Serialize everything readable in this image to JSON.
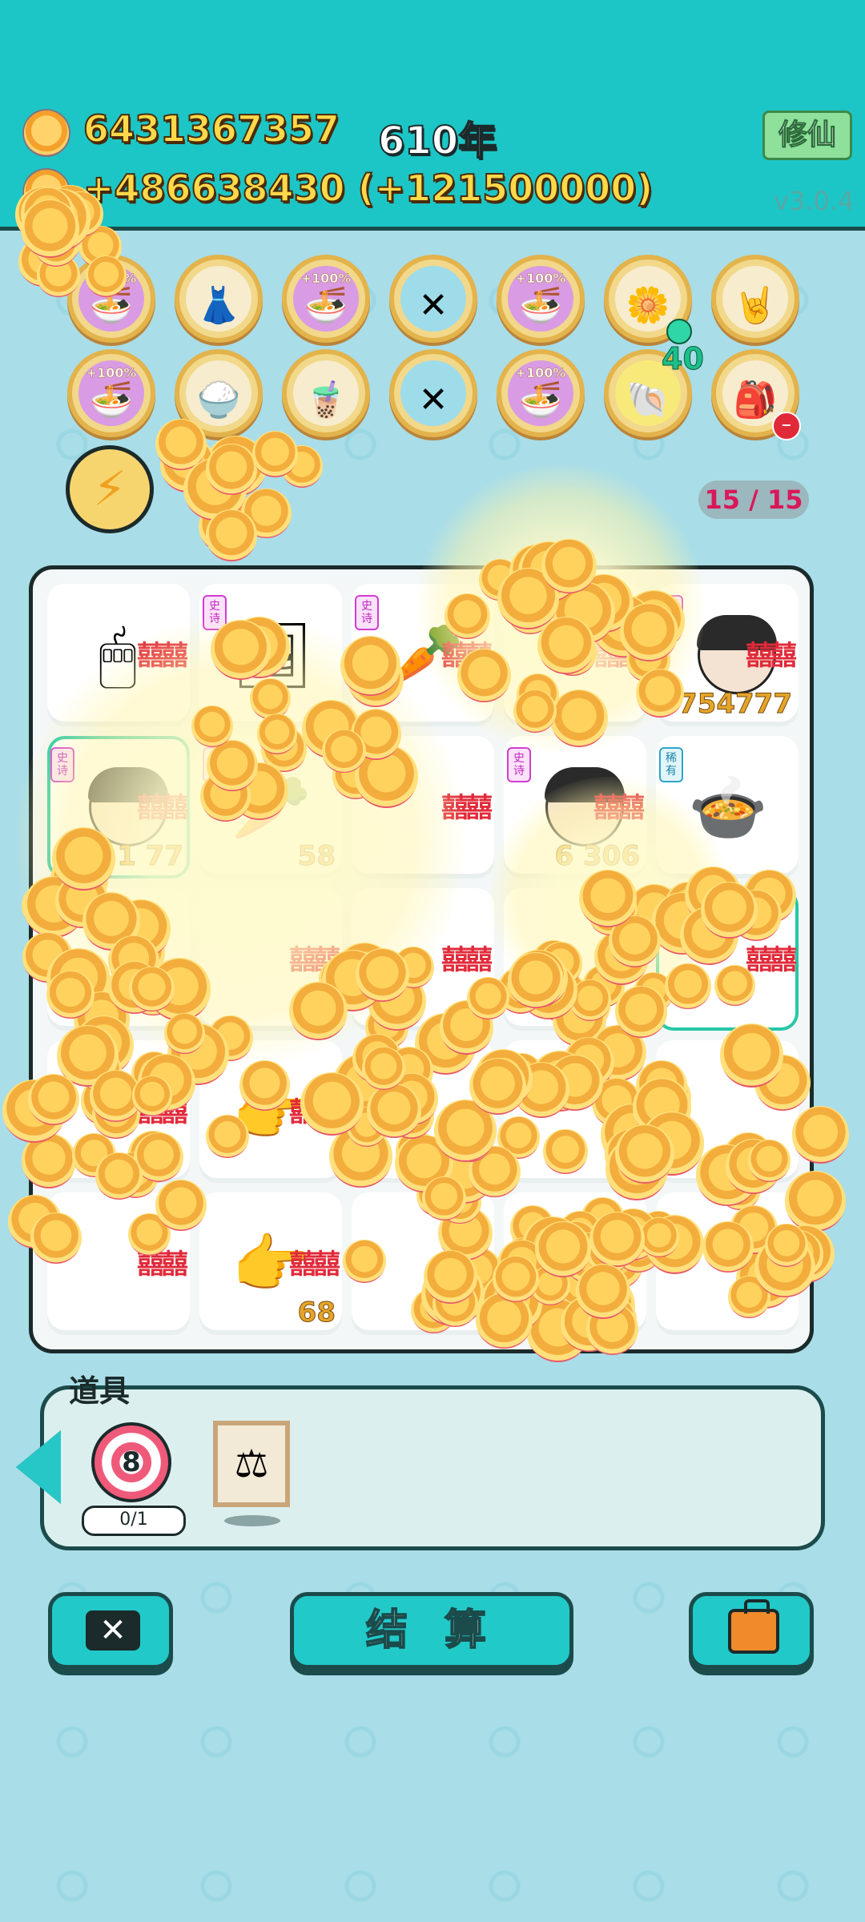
{
  "header": {
    "coins": "6431367357",
    "income": "+486638430 (+121500000)",
    "year": "610年",
    "mode_button": "修仙",
    "version": "v3.0.4"
  },
  "skills": [
    {
      "icon": "cup-boost-icon",
      "label": "+100%"
    },
    {
      "icon": "skirt-icon",
      "label": ""
    },
    {
      "icon": "cup-boost-icon",
      "label": "+100%"
    },
    {
      "icon": "crossed-sticks-icon",
      "label": ""
    },
    {
      "icon": "cup-boost-icon",
      "label": "+100%"
    },
    {
      "icon": "flower-pot-icon",
      "label": ""
    },
    {
      "icon": "rock-hand-icon",
      "label": ""
    },
    {
      "icon": "cup-boost-icon",
      "label": "+100%"
    },
    {
      "icon": "rice-cooker-icon",
      "label": ""
    },
    {
      "icon": "bubble-tea-icon",
      "label": ""
    },
    {
      "icon": "crossed-sticks-icon",
      "label": ""
    },
    {
      "icon": "cup-boost-icon",
      "label": "+100%"
    },
    {
      "icon": "shell-icon",
      "label": ""
    },
    {
      "icon": "bag-icon",
      "label": ""
    }
  ],
  "flower_badge": "40",
  "counter": "15 / 15",
  "board": {
    "cells": [
      {
        "art": "mouse-icon",
        "tag": "",
        "xi": "囍",
        "num": ""
      },
      {
        "art": "frame-icon",
        "tag": "史诗",
        "xi": "",
        "num": ""
      },
      {
        "art": "carrot-icon",
        "tag": "史诗",
        "xi": "囍",
        "num": ""
      },
      {
        "art": "",
        "tag": "",
        "xi": "囍",
        "num": ""
      },
      {
        "art": "face-icon",
        "tag": "史诗",
        "xi": "囍",
        "num": "754777"
      },
      {
        "art": "face-icon",
        "tag": "史诗",
        "xi": "囍",
        "num": "1      77"
      },
      {
        "art": "carrot-icon",
        "tag": "史诗",
        "xi": "",
        "num": "58"
      },
      {
        "art": "",
        "tag": "",
        "xi": "囍",
        "num": ""
      },
      {
        "art": "face-icon",
        "tag": "史诗",
        "xi": "囍",
        "num": "6   306"
      },
      {
        "art": "pot-icon",
        "tag": "稀有",
        "xi": "",
        "num": ""
      },
      {
        "art": "",
        "tag": "",
        "xi": "",
        "num": ""
      },
      {
        "art": "",
        "tag": "",
        "xi": "囍",
        "num": ""
      },
      {
        "art": "",
        "tag": "",
        "xi": "囍",
        "num": ""
      },
      {
        "art": "",
        "tag": "",
        "xi": "",
        "num": ""
      },
      {
        "art": "",
        "tag": "",
        "xi": "囍",
        "num": ""
      },
      {
        "art": "",
        "tag": "",
        "xi": "囍",
        "num": ""
      },
      {
        "art": "pointing-hand-icon",
        "tag": "",
        "xi": "囍",
        "num": ""
      },
      {
        "art": "",
        "tag": "",
        "xi": "",
        "num": ""
      },
      {
        "art": "",
        "tag": "",
        "xi": "",
        "num": ""
      },
      {
        "art": "",
        "tag": "",
        "xi": "",
        "num": ""
      },
      {
        "art": "",
        "tag": "",
        "xi": "囍",
        "num": ""
      },
      {
        "art": "pointing-hand-icon",
        "tag": "",
        "xi": "囍",
        "num": "68"
      },
      {
        "art": "",
        "tag": "",
        "xi": "囍",
        "num": ""
      },
      {
        "art": "",
        "tag": "",
        "xi": "",
        "num": ""
      },
      {
        "art": "",
        "tag": "",
        "xi": "",
        "num": ""
      }
    ]
  },
  "items": {
    "title": "道具",
    "target_count": "8",
    "target_uses": "0/1",
    "frame_icon": "scale-icon"
  },
  "actions": {
    "settle": "结 算"
  }
}
